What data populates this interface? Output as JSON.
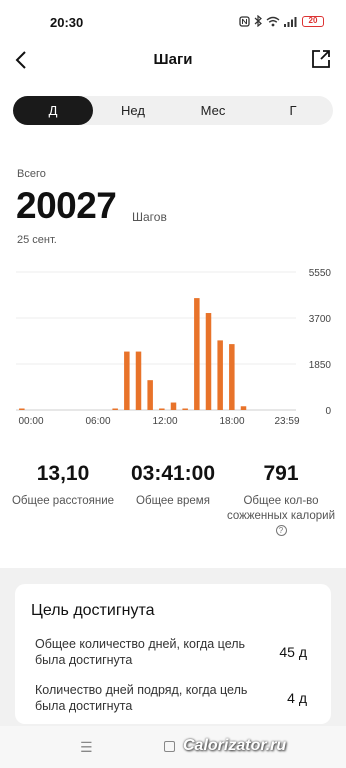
{
  "status": {
    "time": "20:30",
    "icons": [
      "nfc-icon",
      "bluetooth-icon",
      "wifi-icon",
      "signal-icon"
    ],
    "battery": "20"
  },
  "header": {
    "title": "Шаги",
    "back_icon": "chevron-left-icon",
    "export_icon": "export-icon"
  },
  "tabs": [
    {
      "label": "Д",
      "active": true
    },
    {
      "label": "Нед",
      "active": false
    },
    {
      "label": "Мес",
      "active": false
    },
    {
      "label": "Г",
      "active": false
    }
  ],
  "summary": {
    "label": "Всего",
    "value": "20027",
    "unit": "Шагов",
    "date": "25 сент."
  },
  "chart_data": {
    "type": "bar",
    "x": [
      0,
      1,
      2,
      3,
      4,
      5,
      6,
      7,
      8,
      9,
      10,
      11,
      12,
      13,
      14,
      15,
      16,
      17,
      18,
      19,
      20,
      21,
      22,
      23
    ],
    "values": [
      40,
      0,
      0,
      0,
      0,
      0,
      0,
      0,
      20,
      2350,
      2350,
      1200,
      40,
      300,
      50,
      4500,
      3900,
      2800,
      2650,
      150,
      0,
      0,
      0,
      0
    ],
    "ylim": [
      0,
      5550
    ],
    "yticks": [
      "5550",
      "3700",
      "1850",
      "0"
    ],
    "xticks": [
      "00:00",
      "06:00",
      "12:00",
      "18:00",
      "23:59"
    ],
    "bar_color": "#e8732a",
    "grid": true
  },
  "stats": [
    {
      "value": "13,10",
      "label": "Общее расстояние"
    },
    {
      "value": "03:41:00",
      "label": "Общее время"
    },
    {
      "value": "791",
      "label": "Общее кол-во сожженных калорий"
    }
  ],
  "goal": {
    "title": "Цель достигнута",
    "rows": [
      {
        "label": "Общее количество дней, когда цель была достигнута",
        "value": "45 д"
      },
      {
        "label": "Количество дней подряд, когда цель была достигнута",
        "value": "4 д"
      }
    ]
  },
  "watermark": "Calorizator.ru"
}
